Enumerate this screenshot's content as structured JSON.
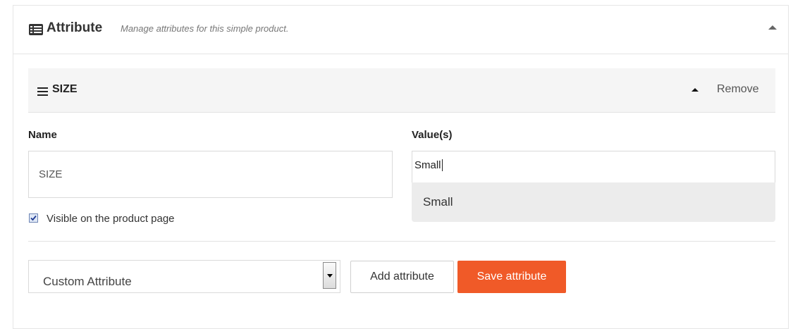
{
  "header": {
    "title": "Attribute",
    "subtitle": "Manage attributes for this simple product.",
    "icon": "list-alt-icon",
    "collapse_icon": "caret-up-icon"
  },
  "attribute": {
    "title": "SIZE",
    "icon": "bars-icon",
    "collapse_icon": "caret-up-icon",
    "remove_label": "Remove",
    "name_label": "Name",
    "name_value": "SIZE",
    "values_label": "Value(s)",
    "values_input": "Small",
    "suggestions": [
      "Small"
    ],
    "visible_label": "Visible on the product page",
    "visible_checked": true
  },
  "footer": {
    "select_value": "Custom Attribute",
    "add_label": "Add attribute",
    "save_label": "Save attribute"
  },
  "colors": {
    "accent": "#f05a28",
    "bar_background": "#f5f5f5",
    "dropdown_background": "#ececec"
  }
}
